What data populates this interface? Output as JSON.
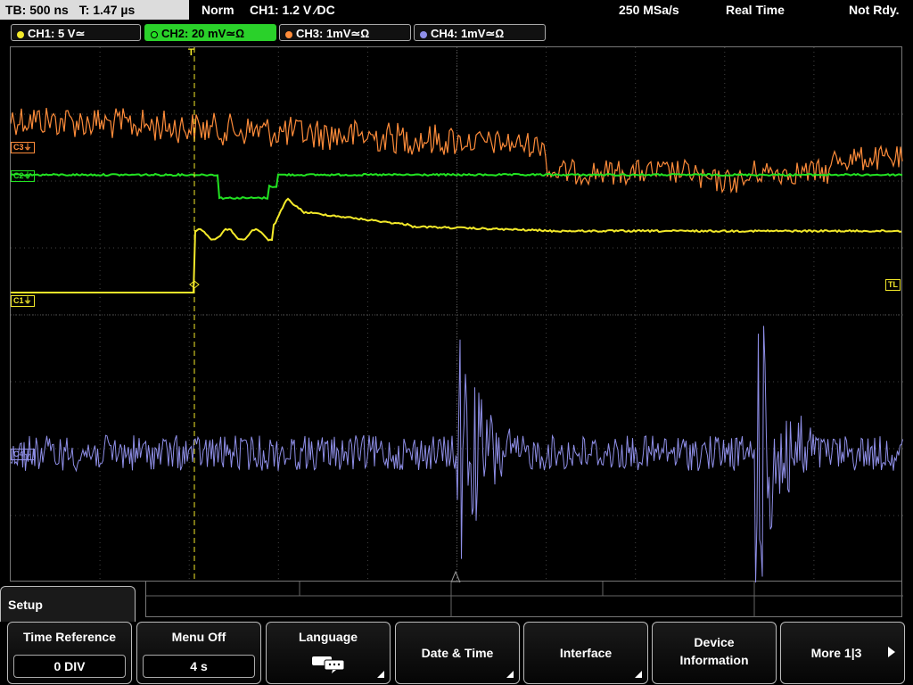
{
  "header": {
    "timebase": "TB: 500 ns",
    "time": "T: 1.47 µs",
    "trigger_mode": "Norm",
    "trigger_info": "CH1: 1.2 V ∕DC",
    "sample_rate": "250 MSa/s",
    "acq_mode": "Real Time",
    "status": "Not Rdy."
  },
  "channels": [
    {
      "label": "CH1: 5 V≃",
      "color": "#f4ea2a"
    },
    {
      "label": "CH2: 20 mV≃Ω",
      "color": "#22e322"
    },
    {
      "label": "CH3: 1mV≃Ω",
      "color": "#ff8c3a"
    },
    {
      "label": "CH4: 1mV≃Ω",
      "color": "#8f8fe8"
    }
  ],
  "markers": {
    "c3": "C3⏚",
    "c2": "C2⏚",
    "c1": "C1⏚",
    "c4": "C4⏚",
    "trigger_level": "TL",
    "trigger_pos": "T"
  },
  "menu": {
    "title": "Setup",
    "keys": [
      {
        "label": "Time Reference",
        "value": "0 DIV"
      },
      {
        "label": "Menu Off",
        "value": "4 s"
      },
      {
        "label": "Language",
        "icon": "speech-bubbles-icon"
      },
      {
        "label": "Date & Time"
      },
      {
        "label": "Interface"
      },
      {
        "label": "Device",
        "label2": "Information"
      },
      {
        "label": "More 1|3"
      }
    ]
  }
}
